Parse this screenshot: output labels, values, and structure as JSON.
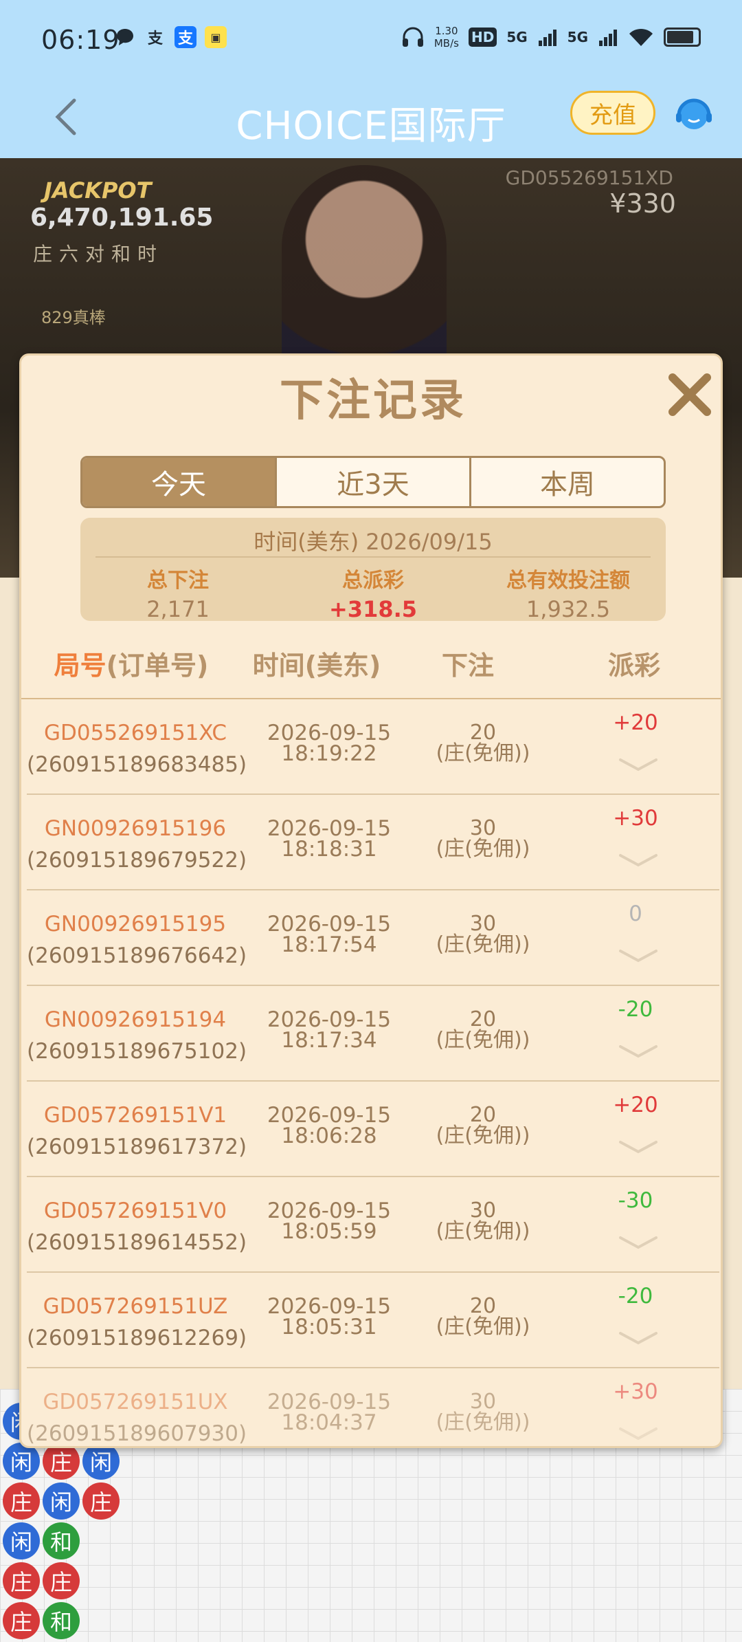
{
  "status_bar": {
    "time": "06:19",
    "net_speed_value": "1.30",
    "net_speed_unit": "MB/s",
    "hd_label": "HD",
    "sim1": "5G",
    "sim2": "5G"
  },
  "header": {
    "title": "CHOICE国际厅",
    "recharge_label": "充值"
  },
  "game": {
    "jackpot_label": "JACKPOT",
    "jackpot_value": "6,470,191.65",
    "jackpot_types": "庄六对和时",
    "likes_text": "829真棒",
    "table_id": "GD055269151XD",
    "amount": "¥330"
  },
  "modal": {
    "title": "下注记录",
    "tabs": [
      {
        "label": "今天",
        "active": true
      },
      {
        "label": "近3天",
        "active": false
      },
      {
        "label": "本周",
        "active": false
      }
    ],
    "summary": {
      "time_label": "时间(美东)",
      "date": "2026/09/15",
      "total_bet_label": "总下注",
      "total_bet": "2,171",
      "total_payout_label": "总派彩",
      "total_payout": "+318.5",
      "total_valid_label": "总有效投注额",
      "total_valid": "1,932.5"
    },
    "columns": {
      "id_prefix": "局号",
      "id_suffix": "(订单号)",
      "time": "时间(美东)",
      "bet": "下注",
      "payout": "派彩"
    },
    "records": [
      {
        "round": "GD055269151XC",
        "order": "(260915189683485)",
        "date": "2026-09-15",
        "time": "18:19:22",
        "amount": "20",
        "bet_type": "(庄(免佣))",
        "payout": "+20",
        "kind": "pos"
      },
      {
        "round": "GN00926915196",
        "order": "(260915189679522)",
        "date": "2026-09-15",
        "time": "18:18:31",
        "amount": "30",
        "bet_type": "(庄(免佣))",
        "payout": "+30",
        "kind": "pos"
      },
      {
        "round": "GN00926915195",
        "order": "(260915189676642)",
        "date": "2026-09-15",
        "time": "18:17:54",
        "amount": "30",
        "bet_type": "(庄(免佣))",
        "payout": "0",
        "kind": "zero"
      },
      {
        "round": "GN00926915194",
        "order": "(260915189675102)",
        "date": "2026-09-15",
        "time": "18:17:34",
        "amount": "20",
        "bet_type": "(庄(免佣))",
        "payout": "-20",
        "kind": "neg"
      },
      {
        "round": "GD057269151V1",
        "order": "(260915189617372)",
        "date": "2026-09-15",
        "time": "18:06:28",
        "amount": "20",
        "bet_type": "(庄(免佣))",
        "payout": "+20",
        "kind": "pos"
      },
      {
        "round": "GD057269151V0",
        "order": "(260915189614552)",
        "date": "2026-09-15",
        "time": "18:05:59",
        "amount": "30",
        "bet_type": "(庄(免佣))",
        "payout": "-30",
        "kind": "neg"
      },
      {
        "round": "GD057269151UZ",
        "order": "(260915189612269)",
        "date": "2026-09-15",
        "time": "18:05:31",
        "amount": "20",
        "bet_type": "(庄(免佣))",
        "payout": "-20",
        "kind": "neg"
      },
      {
        "round": "GD057269151UX",
        "order": "(260915189607930)",
        "date": "2026-09-15",
        "time": "18:04:37",
        "amount": "30",
        "bet_type": "(庄(免佣))",
        "payout": "+30",
        "kind": "pos"
      }
    ]
  },
  "roadmap": {
    "beads": [
      "闲",
      "闲",
      "庄",
      "闲",
      "庄",
      "闲",
      "庄",
      "闲",
      "和",
      "庄",
      "庄",
      "庄",
      "和"
    ],
    "colors": {
      "banker": "#d63a3a",
      "player": "#2f6bd6",
      "tie": "#2e9e3e"
    }
  }
}
